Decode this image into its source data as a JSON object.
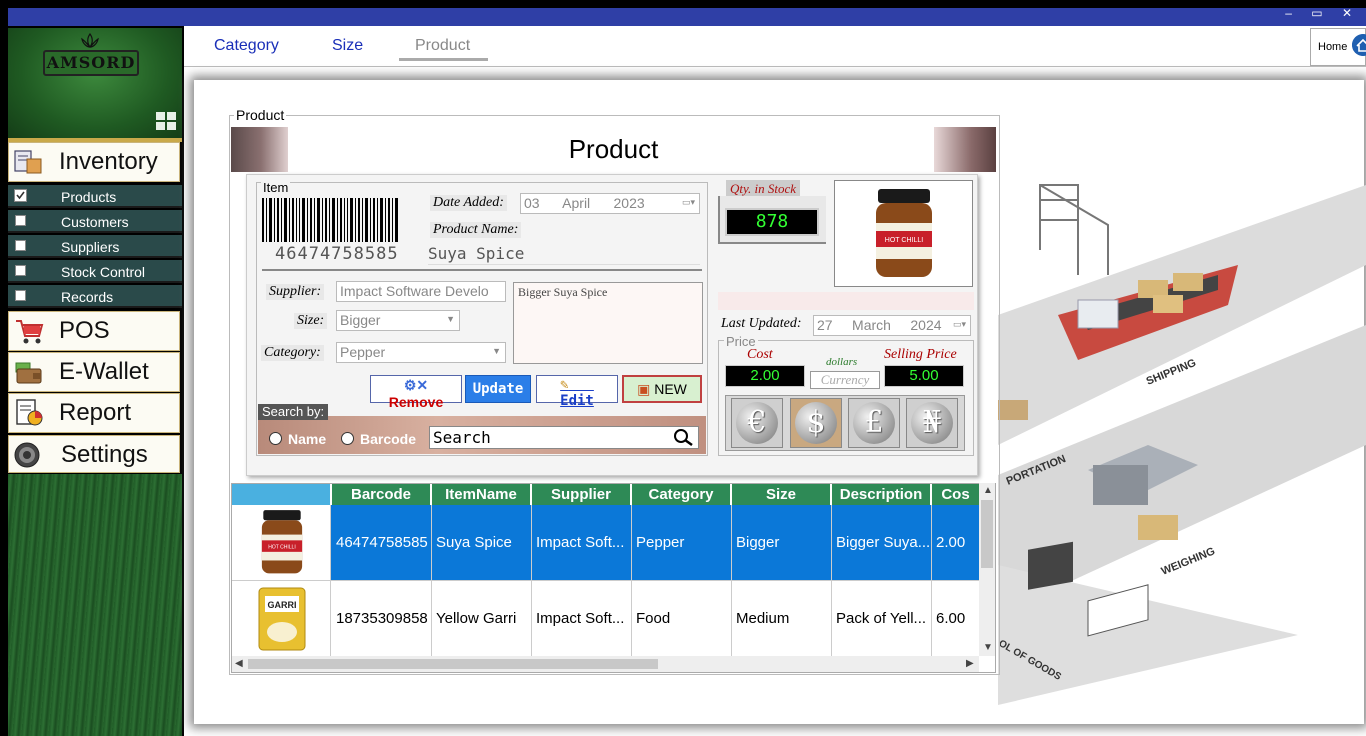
{
  "window": {
    "controls": "– ▭ ✕"
  },
  "sidebar": {
    "logo_text": "AMSORD",
    "main_items": [
      {
        "label": "Inventory",
        "icon": "inventory-icon"
      },
      {
        "label": "POS",
        "icon": "cart-icon"
      },
      {
        "label": "E-Wallet",
        "icon": "wallet-icon"
      },
      {
        "label": "Report",
        "icon": "report-icon"
      },
      {
        "label": "Settings",
        "icon": "gear-icon"
      }
    ],
    "sub_items": [
      {
        "label": "Products",
        "checked": true
      },
      {
        "label": "Customers",
        "checked": false
      },
      {
        "label": "Suppliers",
        "checked": false
      },
      {
        "label": "Stock Control",
        "checked": false
      },
      {
        "label": "Records",
        "checked": false
      }
    ]
  },
  "tabs": [
    {
      "label": "Category"
    },
    {
      "label": "Size"
    },
    {
      "label": "Product",
      "active": true
    }
  ],
  "home": {
    "label": "Home"
  },
  "product": {
    "group_label": "Product",
    "banner_title": "Product",
    "item_group_label": "Item",
    "barcode": "46474758585",
    "date_added_label": "Date Added:",
    "date_added": {
      "day": "03",
      "month": "April",
      "year": "2023"
    },
    "product_name_label": "Product Name:",
    "product_name": "Suya Spice",
    "supplier_label": "Supplier:",
    "supplier": "Impact Software Develo",
    "size_label": "Size:",
    "size": "Bigger",
    "category_label": "Category:",
    "category": "Pepper",
    "description": "Bigger Suya Spice",
    "buttons": {
      "remove": "Remove",
      "update": "Update",
      "edit": "Edit",
      "new": "NEW"
    },
    "search_by_label": "Search by:",
    "search_name": "Name",
    "search_barcode": "Barcode",
    "search_placeholder": "Search",
    "qty_label": "Qty. in Stock",
    "qty": "878",
    "last_updated_label": "Last Updated:",
    "last_updated": {
      "day": "27",
      "month": "March",
      "year": "2024"
    },
    "price_label": "Price",
    "cost_label": "Cost",
    "cost": "2.00",
    "dollars_label": "dollars",
    "currency_placeholder": "Currency",
    "selling_label": "Selling Price",
    "selling": "5.00",
    "coins": [
      "€",
      "$",
      "£",
      "₦"
    ]
  },
  "grid": {
    "columns": [
      "",
      "Barcode",
      "ItemName",
      "Supplier",
      "Category",
      "Size",
      "Description",
      "Cos"
    ],
    "rows": [
      [
        "46474758585",
        "Suya Spice",
        "Impact Soft...",
        "Pepper",
        "Bigger",
        "Bigger Suya...",
        "2.00"
      ],
      [
        "18735309858",
        "Yellow Garri",
        "Impact Soft...",
        "Food",
        "Medium",
        "Pack of Yell...",
        "6.00"
      ]
    ],
    "thumb1_text": "HOT CHILLI",
    "thumb2_text": "GARRI"
  },
  "colors": {
    "accent_green": "#2e8a56",
    "selected_row": "#0b78d8",
    "tab_blue": "#1a2fb8"
  }
}
